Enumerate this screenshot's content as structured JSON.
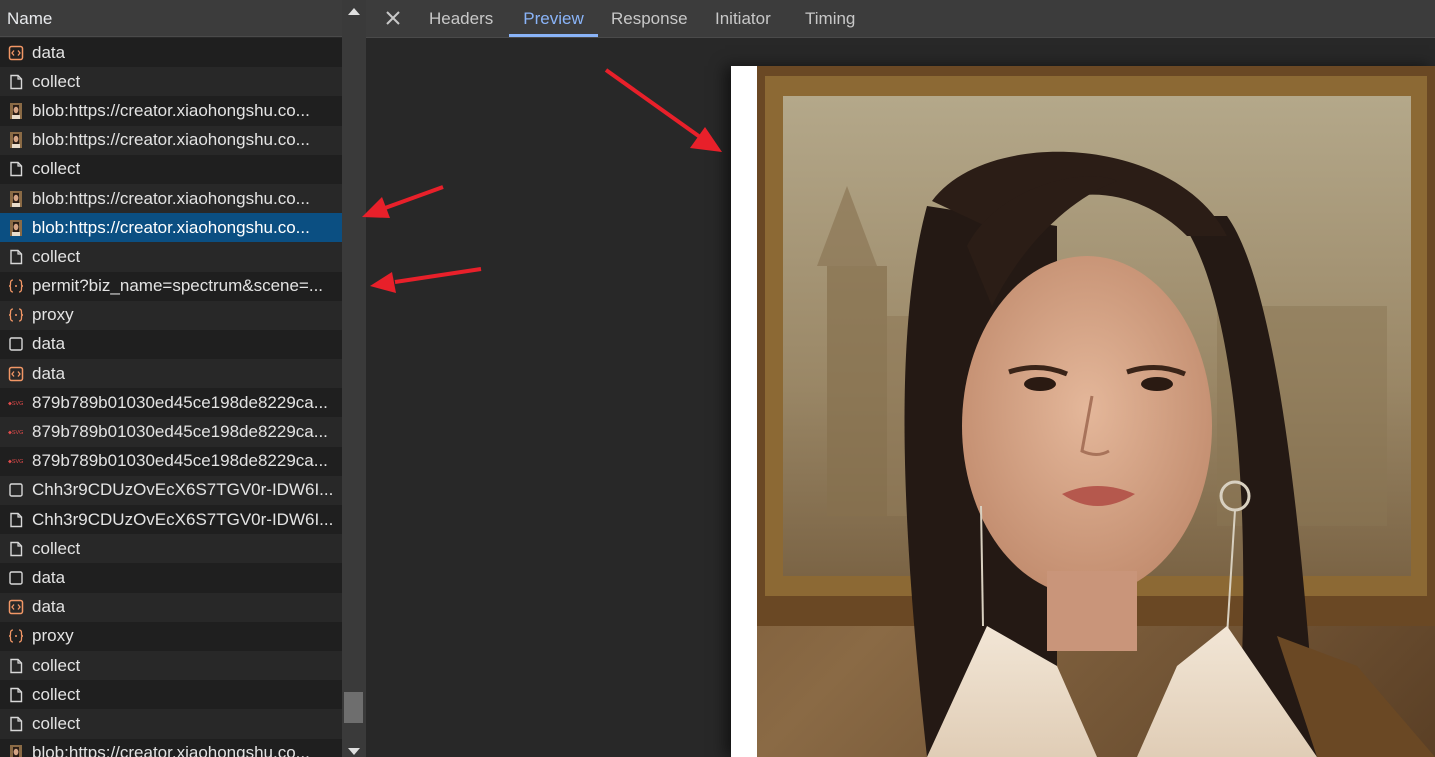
{
  "network_list": {
    "column_header": "Name",
    "rows": [
      {
        "label": "data",
        "icon": "xhr-doc-icon"
      },
      {
        "label": "collect",
        "icon": "document-icon"
      },
      {
        "label": "blob:https://creator.xiaohongshu.co...",
        "icon": "image-thumb-icon"
      },
      {
        "label": "blob:https://creator.xiaohongshu.co...",
        "icon": "image-thumb-icon"
      },
      {
        "label": "collect",
        "icon": "document-icon"
      },
      {
        "label": "blob:https://creator.xiaohongshu.co...",
        "icon": "image-thumb-icon"
      },
      {
        "label": "blob:https://creator.xiaohongshu.co...",
        "icon": "image-thumb-icon",
        "selected": true
      },
      {
        "label": "collect",
        "icon": "document-icon"
      },
      {
        "label": "permit?biz_name=spectrum&scene=...",
        "icon": "json-icon"
      },
      {
        "label": "proxy",
        "icon": "json-icon"
      },
      {
        "label": "data",
        "icon": "empty-doc-icon"
      },
      {
        "label": "data",
        "icon": "xhr-doc-icon"
      },
      {
        "label": "879b789b01030ed45ce198de8229ca...",
        "icon": "svg-icon"
      },
      {
        "label": "879b789b01030ed45ce198de8229ca...",
        "icon": "svg-icon"
      },
      {
        "label": "879b789b01030ed45ce198de8229ca...",
        "icon": "svg-icon"
      },
      {
        "label": "Chh3r9CDUzOvEcX6S7TGV0r-IDW6I...",
        "icon": "empty-doc-icon"
      },
      {
        "label": "Chh3r9CDUzOvEcX6S7TGV0r-IDW6I...",
        "icon": "document-icon"
      },
      {
        "label": "collect",
        "icon": "document-icon"
      },
      {
        "label": "data",
        "icon": "empty-doc-icon"
      },
      {
        "label": "data",
        "icon": "xhr-doc-icon"
      },
      {
        "label": "proxy",
        "icon": "json-icon"
      },
      {
        "label": "collect",
        "icon": "document-icon"
      },
      {
        "label": "collect",
        "icon": "document-icon"
      },
      {
        "label": "collect",
        "icon": "document-icon"
      },
      {
        "label": "blob:https://creator.xiaohongshu.co...",
        "icon": "image-thumb-icon"
      }
    ]
  },
  "detail_tabs": {
    "close_icon": "close-icon",
    "tabs": [
      {
        "label": "Headers",
        "active": false
      },
      {
        "label": "Preview",
        "active": true
      },
      {
        "label": "Response",
        "active": false
      },
      {
        "label": "Initiator",
        "active": false
      },
      {
        "label": "Timing",
        "active": false
      }
    ]
  },
  "colors": {
    "selected_row": "#0b4f82",
    "active_tab": "#8ab4f8",
    "annotation_arrow": "#e8202a"
  }
}
